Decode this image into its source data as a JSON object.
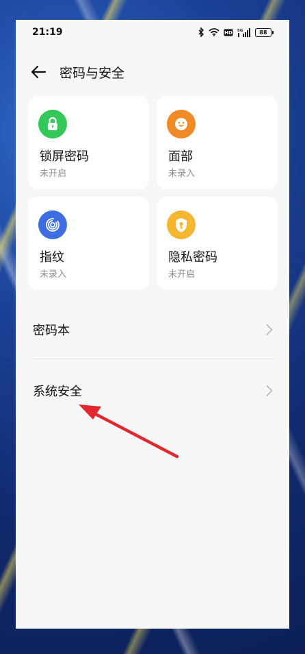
{
  "status_bar": {
    "time": "21:19",
    "battery": "88",
    "icons": [
      "bluetooth-icon",
      "wifi-icon",
      "hd-icon",
      "signal-5g-icon",
      "battery-icon"
    ]
  },
  "header": {
    "title": "密码与安全",
    "back_icon": "arrow-left-icon"
  },
  "cards": [
    {
      "title": "锁屏密码",
      "status": "未开启",
      "icon": "lock-icon",
      "color": "#34c759"
    },
    {
      "title": "面部",
      "status": "未录入",
      "icon": "face-icon",
      "color": "#f08a24"
    },
    {
      "title": "指纹",
      "status": "未录入",
      "icon": "fingerprint-icon",
      "color": "#3d6de0"
    },
    {
      "title": "隐私密码",
      "status": "未开启",
      "icon": "shield-key-icon",
      "color": "#f5b731"
    }
  ],
  "rows": [
    {
      "label": "密码本"
    },
    {
      "label": "系统安全"
    }
  ],
  "annotation": {
    "arrow_color": "#e0282e"
  }
}
